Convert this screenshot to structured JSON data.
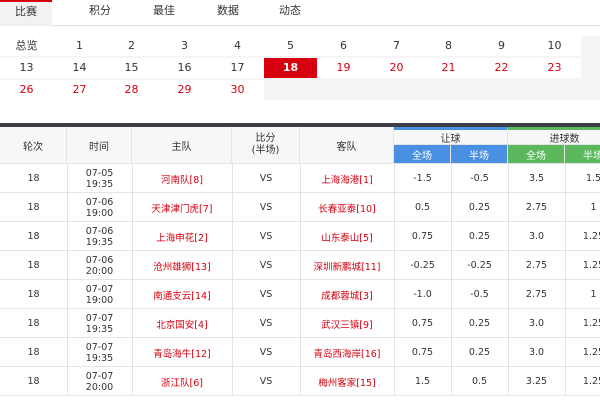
{
  "tabs": [
    {
      "label": "比赛",
      "active": true
    },
    {
      "label": "积分",
      "active": false
    },
    {
      "label": "最佳",
      "active": false
    },
    {
      "label": "数据",
      "active": false
    },
    {
      "label": "动态",
      "active": false
    }
  ],
  "rounds": {
    "label": "总览",
    "items": [
      {
        "n": "1",
        "state": "black"
      },
      {
        "n": "2",
        "state": "black"
      },
      {
        "n": "3",
        "state": "black"
      },
      {
        "n": "4",
        "state": "black"
      },
      {
        "n": "5",
        "state": "black"
      },
      {
        "n": "6",
        "state": "black"
      },
      {
        "n": "7",
        "state": "black"
      },
      {
        "n": "8",
        "state": "black"
      },
      {
        "n": "9",
        "state": "black"
      },
      {
        "n": "10",
        "state": "black"
      },
      {
        "n": "13",
        "state": "black"
      },
      {
        "n": "14",
        "state": "black"
      },
      {
        "n": "15",
        "state": "black"
      },
      {
        "n": "16",
        "state": "black"
      },
      {
        "n": "17",
        "state": "black"
      },
      {
        "n": "18",
        "state": "active"
      },
      {
        "n": "19",
        "state": "red"
      },
      {
        "n": "20",
        "state": "red"
      },
      {
        "n": "21",
        "state": "red"
      },
      {
        "n": "22",
        "state": "red"
      },
      {
        "n": "23",
        "state": "red"
      },
      {
        "n": "26",
        "state": "red"
      },
      {
        "n": "27",
        "state": "red"
      },
      {
        "n": "28",
        "state": "red"
      },
      {
        "n": "29",
        "state": "red"
      },
      {
        "n": "30",
        "state": "red"
      }
    ]
  },
  "table": {
    "headers": {
      "round": "轮次",
      "time": "时间",
      "home": "主队",
      "score_line1": "比分",
      "score_line2": "(半场)",
      "away": "客队",
      "handicap": "让球",
      "total": "进球数",
      "full": "全场",
      "half": "半场"
    },
    "rows": [
      {
        "round": "18",
        "date": "07-05",
        "time": "19:35",
        "home": "河南队[8]",
        "score": "VS",
        "away": "上海海港[1]",
        "h_full": "-1.5",
        "h_half": "-0.5",
        "t_full": "3.5",
        "t_half": "1.5"
      },
      {
        "round": "18",
        "date": "07-06",
        "time": "19:00",
        "home": "天津津门虎[7]",
        "score": "VS",
        "away": "长春亚泰[10]",
        "h_full": "0.5",
        "h_half": "0.25",
        "t_full": "2.75",
        "t_half": "1"
      },
      {
        "round": "18",
        "date": "07-06",
        "time": "19:35",
        "home": "上海申花[2]",
        "score": "VS",
        "away": "山东泰山[5]",
        "h_full": "0.75",
        "h_half": "0.25",
        "t_full": "3.0",
        "t_half": "1.25"
      },
      {
        "round": "18",
        "date": "07-06",
        "time": "20:00",
        "home": "沧州雄狮[13]",
        "score": "VS",
        "away": "深圳新鹏城[11]",
        "h_full": "-0.25",
        "h_half": "-0.25",
        "t_full": "2.75",
        "t_half": "1.25"
      },
      {
        "round": "18",
        "date": "07-07",
        "time": "19:00",
        "home": "南通支云[14]",
        "score": "VS",
        "away": "成都蓉城[3]",
        "h_full": "-1.0",
        "h_half": "-0.5",
        "t_full": "2.75",
        "t_half": "1"
      },
      {
        "round": "18",
        "date": "07-07",
        "time": "19:35",
        "home": "北京国安[4]",
        "score": "VS",
        "away": "武汉三镇[9]",
        "h_full": "0.75",
        "h_half": "0.25",
        "t_full": "3.0",
        "t_half": "1.25"
      },
      {
        "round": "18",
        "date": "07-07",
        "time": "19:35",
        "home": "青岛海牛[12]",
        "score": "VS",
        "away": "青岛西海岸[16]",
        "h_full": "0.75",
        "h_half": "0.25",
        "t_full": "3.0",
        "t_half": "1.25"
      },
      {
        "round": "18",
        "date": "07-07",
        "time": "20:00",
        "home": "浙江队[6]",
        "score": "VS",
        "away": "梅州客家[15]",
        "h_full": "1.5",
        "h_half": "0.5",
        "t_full": "3.25",
        "t_half": "1.25"
      }
    ]
  }
}
